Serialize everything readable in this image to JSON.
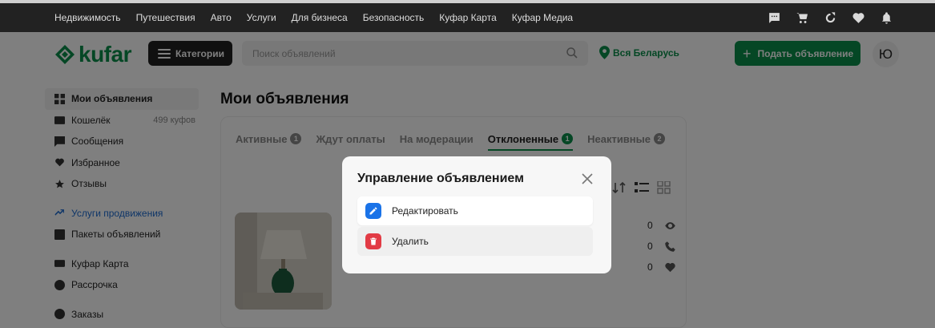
{
  "topnav": [
    "Недвижимость",
    "Путешествия",
    "Авто",
    "Услуги",
    "Для бизнеса",
    "Безопасность",
    "Куфар Карта",
    "Куфар Медиа"
  ],
  "top_icons": [
    "chat-icon",
    "cart-icon",
    "compare-icon",
    "heart-icon",
    "bell-icon"
  ],
  "header": {
    "logo_text": "kufar",
    "categories_label": "Категории",
    "search_placeholder": "Поиск объявлений",
    "region_label": "Вся Беларусь",
    "post_label": "Подать объявление",
    "avatar_letter": "Ю"
  },
  "sidebar": {
    "group1": [
      {
        "label": "Мои объявления",
        "icon": "grid-icon",
        "active": true
      },
      {
        "label": "Кошелёк",
        "icon": "wallet-icon",
        "extra": "499 куфов"
      },
      {
        "label": "Сообщения",
        "icon": "chat-icon"
      },
      {
        "label": "Избранное",
        "icon": "heart-icon"
      },
      {
        "label": "Отзывы",
        "icon": "star-icon"
      }
    ],
    "group2": [
      {
        "label": "Услуги продвижения",
        "icon": "trend-icon",
        "highlight": true
      },
      {
        "label": "Пакеты объявлений",
        "icon": "package-icon"
      }
    ],
    "group3": [
      {
        "label": "Куфар Карта",
        "icon": "card-icon"
      },
      {
        "label": "Рассрочка",
        "icon": "installment-icon"
      }
    ],
    "group4": [
      {
        "label": "Заказы",
        "icon": "orders-icon"
      }
    ]
  },
  "main": {
    "title": "Мои объявления",
    "tabs": [
      {
        "label": "Активные",
        "badge": "1"
      },
      {
        "label": "Ждут оплаты",
        "badge": ""
      },
      {
        "label": "На модерации",
        "badge": ""
      },
      {
        "label": "Отклоненные",
        "badge": "1",
        "active": true
      },
      {
        "label": "Неактивные",
        "badge": "2"
      }
    ],
    "ad": {
      "views": "0",
      "calls": "0",
      "favorites": "0"
    }
  },
  "modal": {
    "title": "Управление объявлением",
    "options": [
      {
        "label": "Редактировать",
        "icon": "pencil-icon"
      },
      {
        "label": "Удалить",
        "icon": "trash-icon"
      }
    ]
  },
  "colors": {
    "brand": "#0a8f4a",
    "dark": "#222222",
    "edit_accent": "#1a73e8",
    "delete_accent": "#e23b45"
  }
}
